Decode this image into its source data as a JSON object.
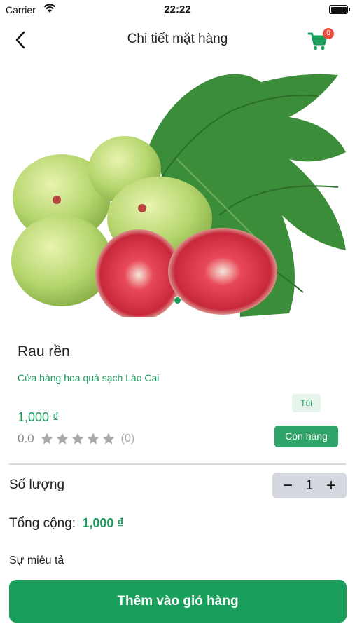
{
  "status_bar": {
    "carrier": "Carrier",
    "time": "22:22"
  },
  "nav": {
    "title": "Chi tiết mặt hàng",
    "cart_count": "0"
  },
  "product": {
    "name": "Rau rền",
    "store": "Cửa hàng hoa quả sạch Lào Cai",
    "unit": "Túi",
    "price": "1,000 ₫",
    "rating_value": "0.0",
    "rating_stars": 0,
    "rating_max": 5,
    "rating_count": "(0)",
    "stock_status": "Còn hàng"
  },
  "quantity": {
    "label": "Số lượng",
    "minus": "−",
    "value": "1",
    "plus": "+"
  },
  "total": {
    "label": "Tổng cộng:",
    "value": "1,000 ₫"
  },
  "description": {
    "label": "Sự miêu tả"
  },
  "actions": {
    "add_to_cart": "Thêm vào giỏ hàng"
  },
  "colors": {
    "accent": "#1a9e5c",
    "badge": "#e74c3c",
    "stepper_bg": "#d5d8de"
  },
  "icons": {
    "back": "chevron-left-icon",
    "cart": "shopping-cart-icon",
    "star": "star-icon"
  }
}
